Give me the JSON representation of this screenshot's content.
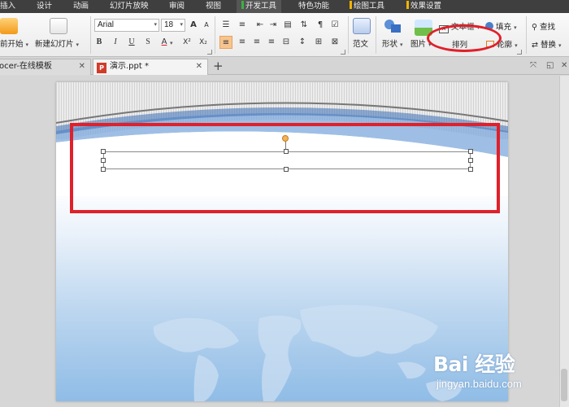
{
  "menu_tabs": [
    {
      "label": "插入"
    },
    {
      "label": "设计"
    },
    {
      "label": "动画"
    },
    {
      "label": "幻灯片放映"
    },
    {
      "label": "审阅"
    },
    {
      "label": "视图"
    },
    {
      "label": "开发工具",
      "mark_color": "#3cb043"
    },
    {
      "label": "特色功能"
    },
    {
      "label": "绘图工具",
      "mark_color": "#f0b400"
    },
    {
      "label": "效果设置",
      "mark_color": "#f0b400"
    }
  ],
  "ribbon": {
    "from_current": "前开始",
    "new_slide": "新建幻灯片",
    "font_name": "Arial",
    "font_size": "18",
    "grow_font": "A",
    "shrink_font": "A",
    "bold": "B",
    "italic": "I",
    "underline": "U",
    "strike": "S",
    "font_color": "A",
    "superscript": "X²",
    "subscript": "X₂",
    "template": "范文",
    "shape": "形状",
    "picture": "图片",
    "arrange": "排列",
    "textbox": "文本框",
    "fill": "填充",
    "outline": "轮廓",
    "find": "查找",
    "replace": "替换"
  },
  "doc_tabs": [
    {
      "label": "ocer-在线模板"
    },
    {
      "label": "演示.ppt *"
    }
  ],
  "watermark": {
    "logo": "Bai 经验",
    "url": "jingyan.baidu.com"
  },
  "colors": {
    "highlight": "#e0202a",
    "menubar": "#3f3f3f",
    "accent": "#f6c58f"
  }
}
